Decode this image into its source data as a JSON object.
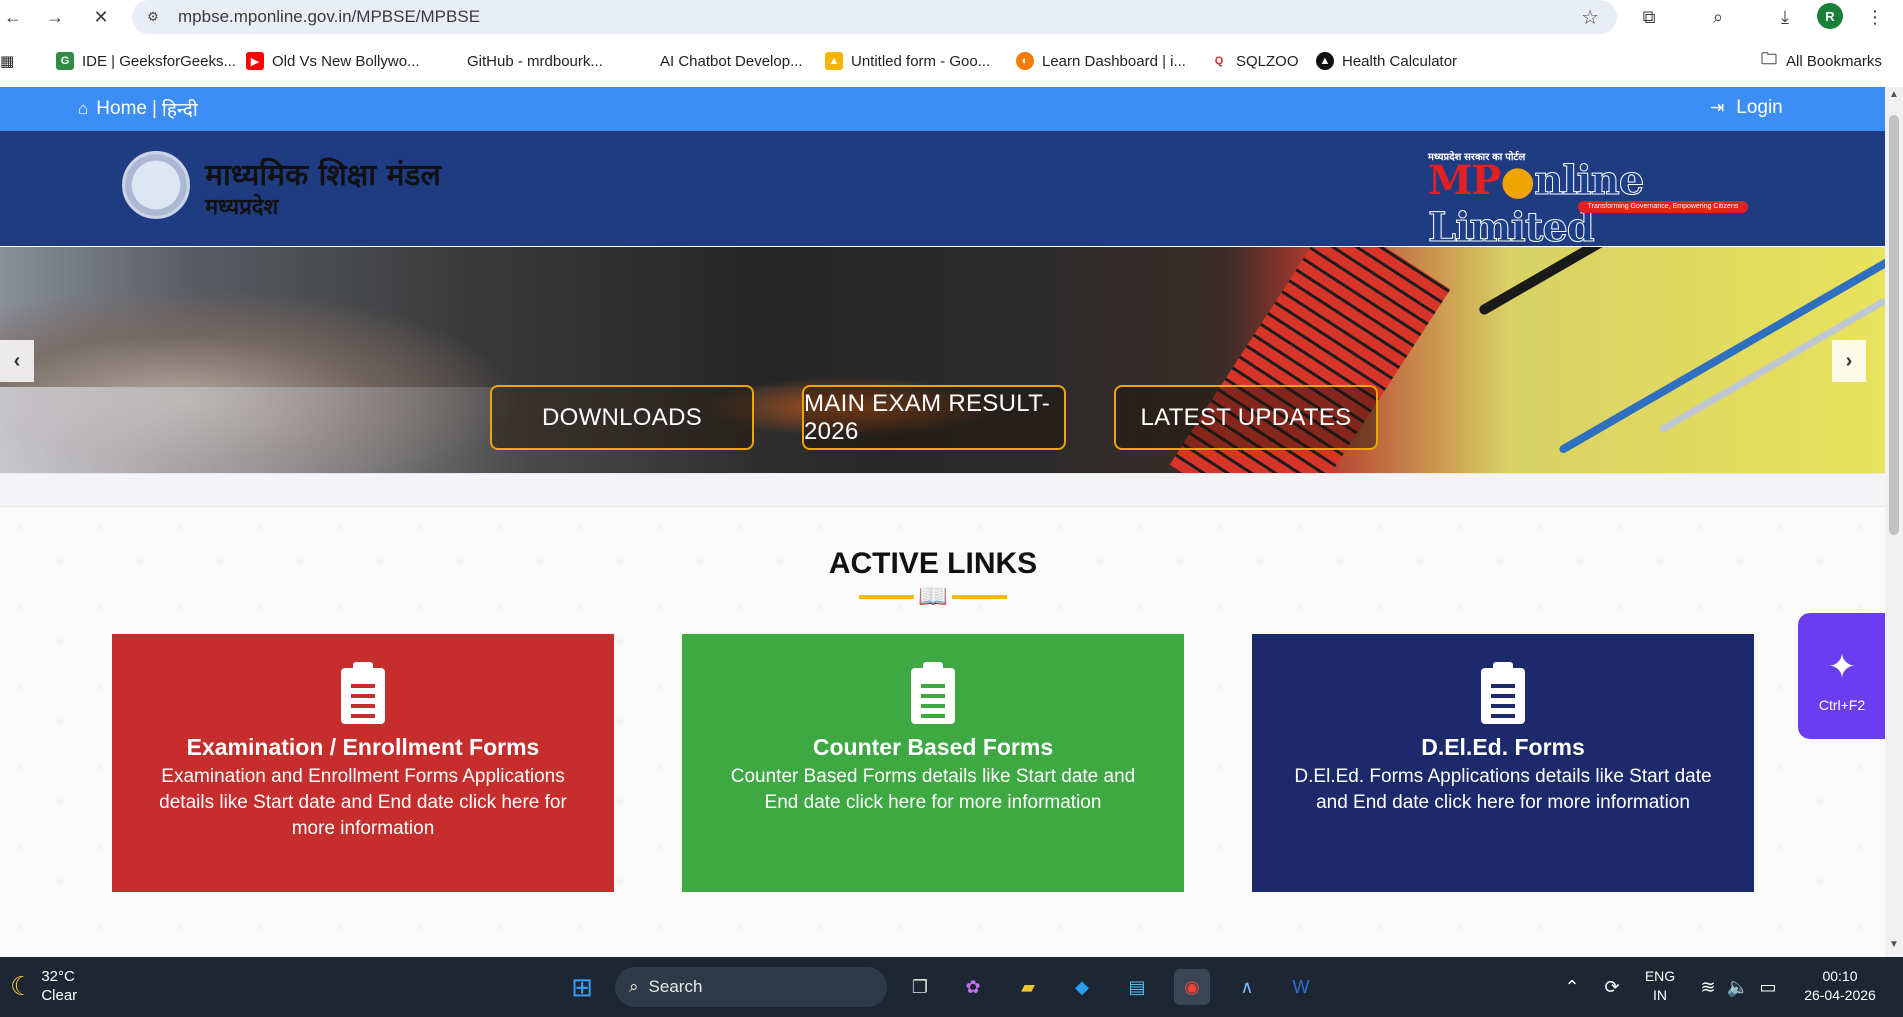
{
  "browser": {
    "url": "mpbse.mponline.gov.in/MPBSE/MPBSE",
    "bookmarks": [
      "IDE | GeeksforGeeks...",
      "Old Vs New Bollywo...",
      "GitHub - mrdbourk...",
      "AI Chatbot Develop...",
      "Untitled form - Goo...",
      "Learn Dashboard | i...",
      "SQLZOO",
      "Health Calculator"
    ],
    "all_bookmarks": "All Bookmarks",
    "profile_initial": "R"
  },
  "topbar": {
    "home": "Home",
    "separator": "|",
    "hindi": "हिन्दी",
    "login": "Login"
  },
  "header": {
    "title": "माध्यमिक शिक्षा मंडल",
    "subtitle": "मध्यप्रदेश",
    "mp_tag": "मध्यप्रदेश सरकार का पोर्टल",
    "mp_prefix": "MP",
    "mp_name": "nline Limited",
    "mp_strap": "Transforming Governance, Empowering Citizens"
  },
  "banner": {
    "buttons": [
      "DOWNLOADS",
      "MAIN EXAM RESULT-2026",
      "LATEST UPDATES"
    ]
  },
  "active_links": {
    "title": "ACTIVE LINKS",
    "cards": [
      {
        "title": "Examination / Enrollment Forms",
        "desc": "Examination and Enrollment Forms Applications details like Start date and End date click here for more information",
        "color": "#c62d2d"
      },
      {
        "title": "Counter Based Forms",
        "desc": "Counter Based Forms details like Start date and End date click here for more information",
        "color": "#3ea843"
      },
      {
        "title": "D.El.Ed. Forms",
        "desc": "D.El.Ed. Forms Applications details like Start date and End date click here for more information",
        "color": "#1c2a6b"
      }
    ]
  },
  "accessibility": {
    "shortcut": "Ctrl+F2"
  },
  "taskbar": {
    "temp": "32°C",
    "condition": "Clear",
    "search": "Search",
    "lang_top": "ENG",
    "lang_bottom": "IN",
    "time": "00:10",
    "date": "26-04-2026"
  }
}
